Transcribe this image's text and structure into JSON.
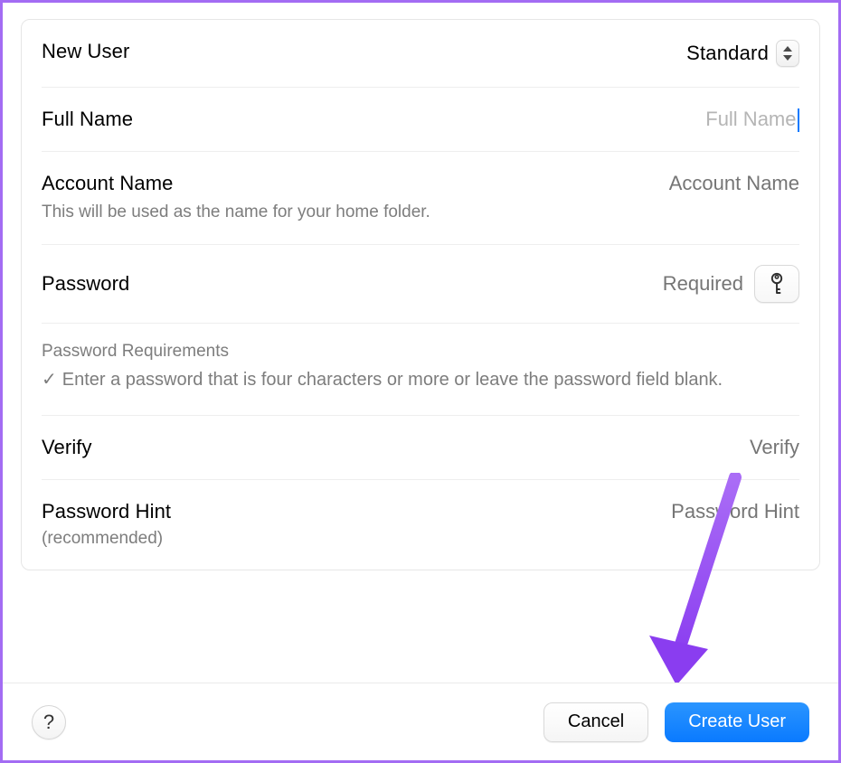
{
  "rows": {
    "newUser": {
      "label": "New User",
      "selectedValue": "Standard"
    },
    "fullName": {
      "label": "Full Name",
      "placeholder": "Full Name",
      "value": ""
    },
    "accountName": {
      "label": "Account Name",
      "sub": "This will be used as the name for your home folder.",
      "placeholder": "Account Name",
      "value": ""
    },
    "password": {
      "label": "Password",
      "placeholder": "Required",
      "value": ""
    },
    "verify": {
      "label": "Verify",
      "placeholder": "Verify",
      "value": ""
    },
    "hint": {
      "label": "Password Hint",
      "sub": "(recommended)",
      "placeholder": "Password Hint",
      "value": ""
    }
  },
  "requirements": {
    "heading": "Password Requirements",
    "line": "Enter a password that is four characters or more or leave the password field blank."
  },
  "footer": {
    "helpGlyph": "?",
    "cancel": "Cancel",
    "createUser": "Create User"
  },
  "colors": {
    "accent": "#0a7aff",
    "frame": "#a36cf3"
  }
}
